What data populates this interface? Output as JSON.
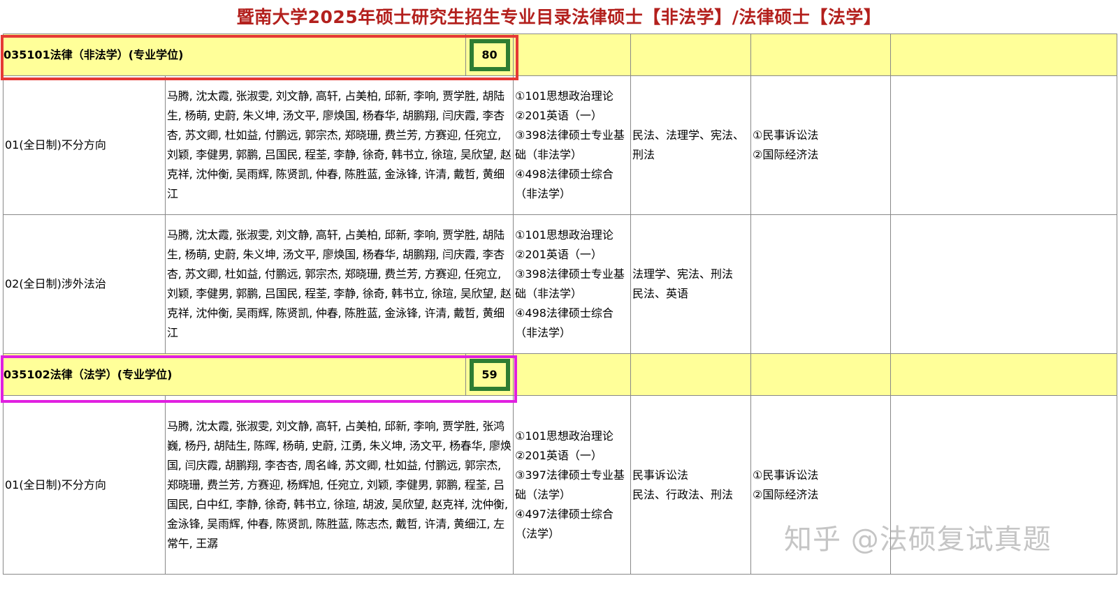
{
  "title": "暨南大学2025年硕士研究生招生专业目录法律硕士【非法学】/法律硕士【法学】",
  "majors": [
    {
      "code_name": "035101法律（非法学）(专业学位)",
      "quota": "80",
      "directions": [
        {
          "direction": "01(全日制)不分方向",
          "teachers": "马腾, 沈太霞, 张淑雯, 刘文静, 高轩, 占美柏, 邱新, 李响, 贾学胜, 胡陆生, 杨萌, 史蔚, 朱义坤, 汤文平, 廖焕国, 杨春华, 胡鹏翔, 闫庆霞, 李杏杏, 苏文卿, 杜如益, 付鹏远, 郭宗杰, 郑晓珊, 费兰芳, 方赛迎, 任宛立, 刘颖, 李健男, 郭鹏, 吕国民, 程荃, 李静, 徐奇, 韩书立, 徐瑄, 吴欣望, 赵克祥, 沈仲衡, 吴雨辉, 陈贤凯, 仲春, 陈胜蓝, 金泳锋, 许清, 戴哲, 黄细江",
          "exams": [
            "①101思想政治理论",
            "②201英语（一）",
            "③398法律硕士专业基础（非法学）",
            "④498法律硕士综合（非法学）"
          ],
          "subjects": [
            "民法、法理学、宪法、刑法"
          ],
          "retest": [
            "①民事诉讼法",
            "②国际经济法"
          ]
        },
        {
          "direction": "02(全日制)涉外法治",
          "teachers": "马腾, 沈太霞, 张淑雯, 刘文静, 高轩, 占美柏, 邱新, 李响, 贾学胜, 胡陆生, 杨萌, 史蔚, 朱义坤, 汤文平, 廖焕国, 杨春华, 胡鹏翔, 闫庆霞, 李杏杏, 苏文卿, 杜如益, 付鹏远, 郭宗杰, 郑晓珊, 费兰芳, 方赛迎, 任宛立, 刘颖, 李健男, 郭鹏, 吕国民, 程荃, 李静, 徐奇, 韩书立, 徐瑄, 吴欣望, 赵克祥, 沈仲衡, 吴雨辉, 陈贤凯, 仲春, 陈胜蓝, 金泳锋, 许清, 戴哲, 黄细江",
          "exams": [
            "①101思想政治理论",
            "②201英语（一）",
            "③398法律硕士专业基础（非法学）",
            "④498法律硕士综合（非法学）"
          ],
          "subjects": [
            "法理学、宪法、刑法",
            "民法、英语"
          ],
          "retest": []
        }
      ]
    },
    {
      "code_name": "035102法律（法学）(专业学位)",
      "quota": "59",
      "directions": [
        {
          "direction": "01(全日制)不分方向",
          "teachers": "马腾, 沈太霞, 张淑雯, 刘文静, 高轩, 占美柏, 邱新, 李响, 贾学胜, 张鸿巍, 杨丹, 胡陆生, 陈晖, 杨萌, 史蔚, 江勇, 朱义坤, 汤文平, 杨春华, 廖焕国, 闫庆霞, 胡鹏翔, 李杏杏, 周名峰, 苏文卿, 杜如益, 付鹏远, 郭宗杰, 郑晓珊, 费兰芳, 方赛迎, 杨辉旭, 任宛立, 刘颖, 李健男, 郭鹏, 程荃, 吕国民, 白中红, 李静, 徐奇, 韩书立, 徐瑄, 胡波, 吴欣望, 赵克祥, 沈仲衡, 金泳锋, 吴雨辉, 仲春, 陈贤凯, 陈胜蓝, 陈志杰, 戴哲, 许清, 黄细江, 左常午, 王潺",
          "exams": [
            "①101思想政治理论",
            "②201英语（一）",
            "③397法律硕士专业基础（法学）",
            "④497法律硕士综合（法学）"
          ],
          "subjects": [
            "民事诉讼法",
            "民法、行政法、刑法"
          ],
          "retest": [
            "①民事诉讼法",
            "②国际经济法"
          ]
        }
      ]
    }
  ],
  "watermark": "知乎 @法硕复试真题",
  "colors": {
    "title": "#b3201d",
    "header_fill": "#ffff99",
    "quota_border": "#2e7d32",
    "highlight_first": "#e53935",
    "highlight_second": "#e020e0"
  }
}
